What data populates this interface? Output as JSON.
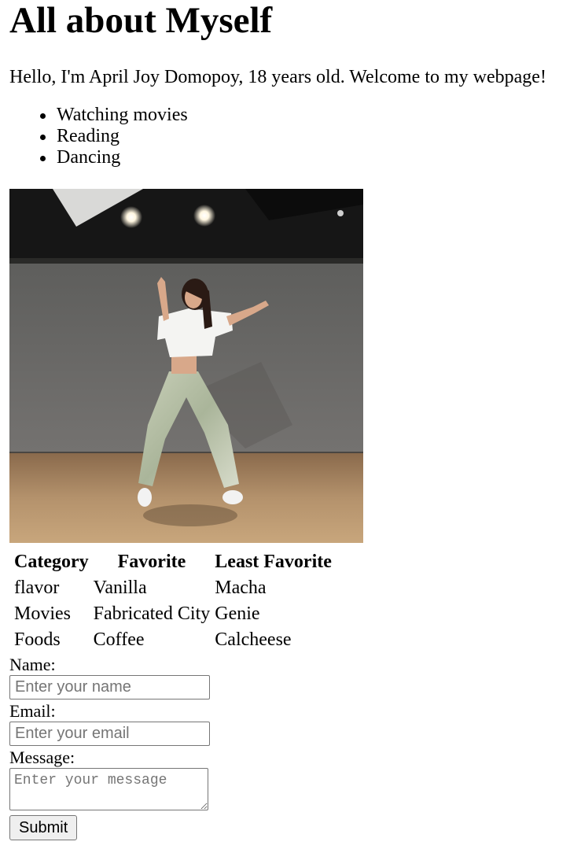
{
  "page": {
    "title": "All about Myself",
    "intro": "Hello, I'm April Joy Domopoy, 18 years old. Welcome to my webpage!"
  },
  "hobbies": [
    "Watching movies",
    "Reading",
    "Dancing"
  ],
  "photo": {
    "subject": "dancer-photo"
  },
  "table": {
    "headers": [
      "Category",
      "Favorite",
      "Least Favorite"
    ],
    "rows": [
      [
        "flavor",
        "Vanilla",
        "Macha"
      ],
      [
        "Movies",
        "Fabricated City",
        "Genie"
      ],
      [
        "Foods",
        "Coffee",
        "Calcheese"
      ]
    ]
  },
  "form": {
    "name_label": "Name:",
    "name_placeholder": "Enter your name",
    "email_label": "Email:",
    "email_placeholder": "Enter your email",
    "message_label": "Message:",
    "message_placeholder": "Enter your message",
    "submit_label": "Submit"
  }
}
